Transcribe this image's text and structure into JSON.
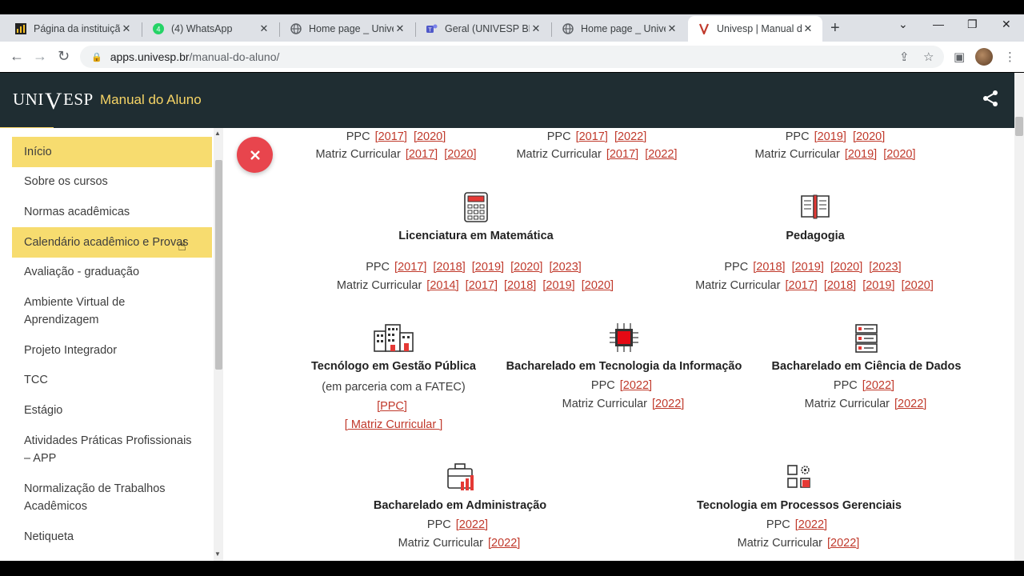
{
  "browser": {
    "tabs": [
      {
        "title": "Página da instituição",
        "icon": "bar-chart-icon"
      },
      {
        "title": "(4) WhatsApp",
        "icon": "whatsapp-icon"
      },
      {
        "title": "Home page _ Univesp",
        "icon": "globe-icon"
      },
      {
        "title": "Geral (UNIVESP BES) |",
        "icon": "teams-icon"
      },
      {
        "title": "Home page _ Univesp",
        "icon": "globe-icon"
      },
      {
        "title": "Univesp | Manual do A",
        "icon": "univesp-icon"
      }
    ],
    "url_host": "apps.univesp.br",
    "url_path": "/manual-do-aluno/"
  },
  "header": {
    "logo_left": "UNI",
    "logo_v": "V",
    "logo_right": "ESP",
    "title": "Manual do Aluno"
  },
  "sidebar": {
    "items": [
      {
        "label": "Início",
        "highlight": true
      },
      {
        "label": "Sobre os cursos",
        "highlight": false
      },
      {
        "label": "Normas acadêmicas",
        "highlight": false
      },
      {
        "label": "Calendário acadêmico e Provas",
        "highlight": true
      },
      {
        "label": "Avaliação - graduação",
        "highlight": false
      },
      {
        "label": "Ambiente Virtual de Aprendizagem",
        "highlight": false
      },
      {
        "label": "Projeto Integrador",
        "highlight": false
      },
      {
        "label": "TCC",
        "highlight": false
      },
      {
        "label": "Estágio",
        "highlight": false
      },
      {
        "label": "Atividades Práticas Profissionais – APP",
        "highlight": false
      },
      {
        "label": "Normalização de Trabalhos Acadêmicos",
        "highlight": false
      },
      {
        "label": "Netiqueta",
        "highlight": false
      }
    ]
  },
  "labels": {
    "ppc": "PPC",
    "matriz": "Matriz Curricular"
  },
  "courses": {
    "top1": {
      "ppc": [
        "2017",
        "2020"
      ],
      "matriz": [
        "2017",
        "2020"
      ]
    },
    "top2": {
      "ppc": [
        "2017",
        "2022"
      ],
      "matriz": [
        "2017",
        "2022"
      ]
    },
    "top3": {
      "ppc": [
        "2019",
        "2020"
      ],
      "matriz": [
        "2019",
        "2020"
      ]
    },
    "matematica": {
      "name": "Licenciatura em Matemática",
      "icon": "calculator-icon",
      "ppc": [
        "2017",
        "2018",
        "2019",
        "2020",
        "2023"
      ],
      "matriz": [
        "2014",
        "2017",
        "2018",
        "2019",
        "2020"
      ]
    },
    "pedagogia": {
      "name": "Pedagogia",
      "icon": "book-icon",
      "ppc": [
        "2018",
        "2019",
        "2020",
        "2023"
      ],
      "matriz": [
        "2017",
        "2018",
        "2019",
        "2020"
      ]
    },
    "gestao": {
      "name": "Tecnólogo em Gestão Pública",
      "subtitle": "(em parceria com a FATEC)",
      "icon": "buildings-icon",
      "ppc_link": "[PPC]",
      "matriz_link": "[ Matriz Curricular ]"
    },
    "ti": {
      "name": "Bacharelado em Tecnologia da Informação",
      "icon": "chip-icon",
      "ppc": [
        "2022"
      ],
      "matriz": [
        "2022"
      ]
    },
    "dados": {
      "name": "Bacharelado em Ciência de Dados",
      "icon": "server-icon",
      "ppc": [
        "2022"
      ],
      "matriz": [
        "2022"
      ]
    },
    "adm": {
      "name": "Bacharelado em Administração",
      "icon": "briefcase-chart-icon",
      "ppc": [
        "2022"
      ],
      "matriz": [
        "2022"
      ]
    },
    "processos": {
      "name": "Tecnologia em Processos Gerenciais",
      "icon": "gear-grid-icon",
      "ppc": [
        "2022"
      ],
      "matriz": [
        "2022"
      ]
    }
  },
  "colors": {
    "header_bg": "#1f2d32",
    "accent_yellow": "#f7dc6f",
    "link_red": "#c0392b",
    "fab_red": "#e8454d"
  }
}
